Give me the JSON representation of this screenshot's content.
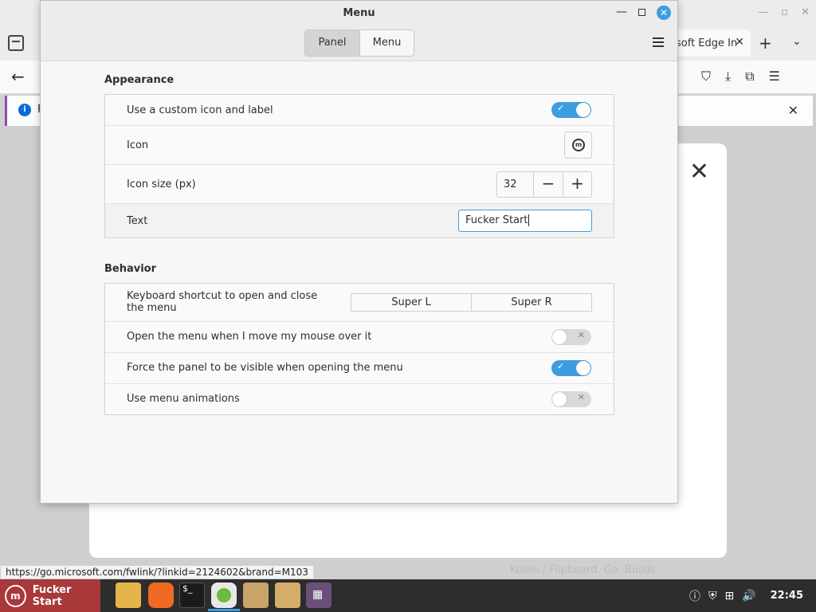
{
  "browser": {
    "tab_title": "soft Edge In",
    "tab_close": "✕",
    "new_tab": "+",
    "tab_list": "⌄",
    "back": "←",
    "notification_text": "F",
    "status_url": "https://go.microsoft.com/fwlink/?linkid=2124602&brand=M103",
    "faded_text": "Kotlin / Flipboard. Go. Builds",
    "win_min": "—",
    "win_max": "▫",
    "win_close": "✕"
  },
  "dialog": {
    "title": "Menu",
    "stack_tabs": [
      {
        "label": "Panel",
        "active": true
      },
      {
        "label": "Menu",
        "active": false
      }
    ],
    "sections": {
      "appearance": {
        "title": "Appearance",
        "custom_icon_label": "Use a custom icon and label",
        "custom_icon_on": true,
        "icon_label": "Icon",
        "icon_size_label": "Icon size (px)",
        "icon_size_value": "32",
        "text_label": "Text",
        "text_value": "Fucker Start"
      },
      "behavior": {
        "title": "Behavior",
        "shortcut_label": "Keyboard shortcut to open and close the menu",
        "shortcut_keys": [
          "Super L",
          "Super R"
        ],
        "hover_label": "Open the menu when I move my mouse over it",
        "hover_on": false,
        "force_panel_label": "Force the panel to be visible when opening the menu",
        "force_panel_on": true,
        "animations_label": "Use menu animations",
        "animations_on": false
      }
    }
  },
  "taskbar": {
    "start_label": "Fucker Start",
    "apps": [
      "files-icon",
      "firefox-icon",
      "terminal-icon",
      "web-app-icon",
      "folder-icon",
      "folder-icon",
      "app-grid-icon"
    ],
    "clock": "22:45"
  },
  "colors": {
    "accent": "#3d9de0",
    "start_button": "#a9383b",
    "taskbar": "#2d2d2d"
  }
}
